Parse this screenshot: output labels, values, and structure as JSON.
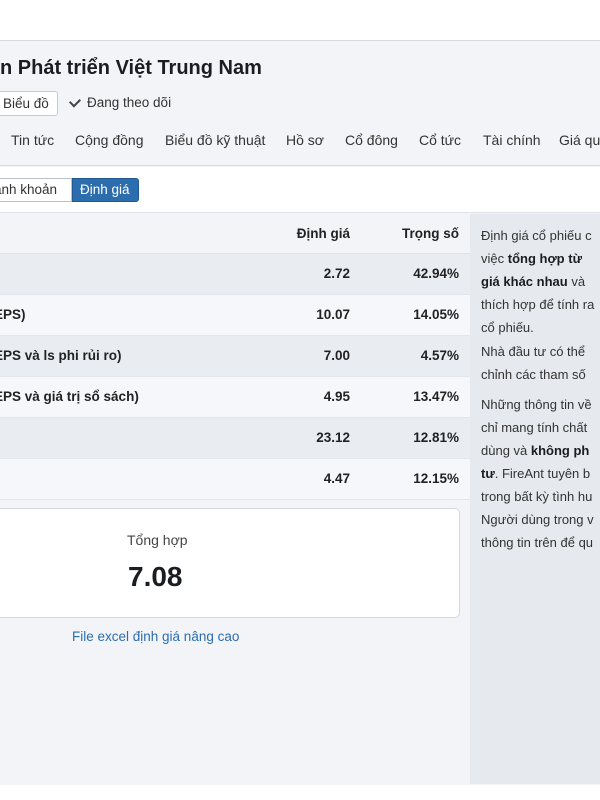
{
  "company_title": "n Phát triển Việt Trung Nam",
  "chart_button": "Biểu đồ",
  "follow_label": "Đang theo dõi",
  "tabs": [
    "Tin tức",
    "Cộng đồng",
    "Biểu đồ kỹ thuật",
    "Hồ sơ",
    "Cổ đông",
    "Cổ tức",
    "Tài chính",
    "Giá qu"
  ],
  "segments": {
    "inactive": "anh khoản",
    "active": "Định giá"
  },
  "table": {
    "headers": {
      "valuation": "Định giá",
      "weight": "Trọng số"
    },
    "rows": [
      {
        "name": "",
        "value": "2.72",
        "weight": "42.94%"
      },
      {
        "name": "EPS)",
        "value": "10.07",
        "weight": "14.05%"
      },
      {
        "name": "EPS và ls phi rủi ro)",
        "value": "7.00",
        "weight": "4.57%"
      },
      {
        "name": "EPS và giá trị sổ sách)",
        "value": "4.95",
        "weight": "13.47%"
      },
      {
        "name": "",
        "value": "23.12",
        "weight": "12.81%"
      },
      {
        "name": "",
        "value": "4.47",
        "weight": "12.15%"
      }
    ]
  },
  "summary": {
    "label": "Tổng hợp",
    "value": "7.08"
  },
  "excel_link": "File excel định giá nâng cao",
  "side_panel": {
    "p1_l1": "Định giá cổ phiếu c",
    "p1_l2_pre": "việc ",
    "p1_l2_bold": "tổng hợp từ",
    "p1_l3_bold": "giá khác nhau",
    "p1_l3_post": " và",
    "p1_l4": "thích hợp để tính ra",
    "p1_l5": "cổ phiếu.",
    "p2_l1": "Nhà đầu tư có thể",
    "p2_l2": "chỉnh các tham số",
    "p3_l1": "Những thông tin về",
    "p3_l2": "chỉ mang tính chất",
    "p3_l3_pre": "dùng và ",
    "p3_l3_bold": "không ph",
    "p3_l4_bold": "tư",
    "p3_l4_post": ". FireAnt tuyên b",
    "p3_l5": "trong bất kỳ tình hu",
    "p3_l6": "Người dùng trong v",
    "p3_l7": "thông tin trên để qu"
  }
}
